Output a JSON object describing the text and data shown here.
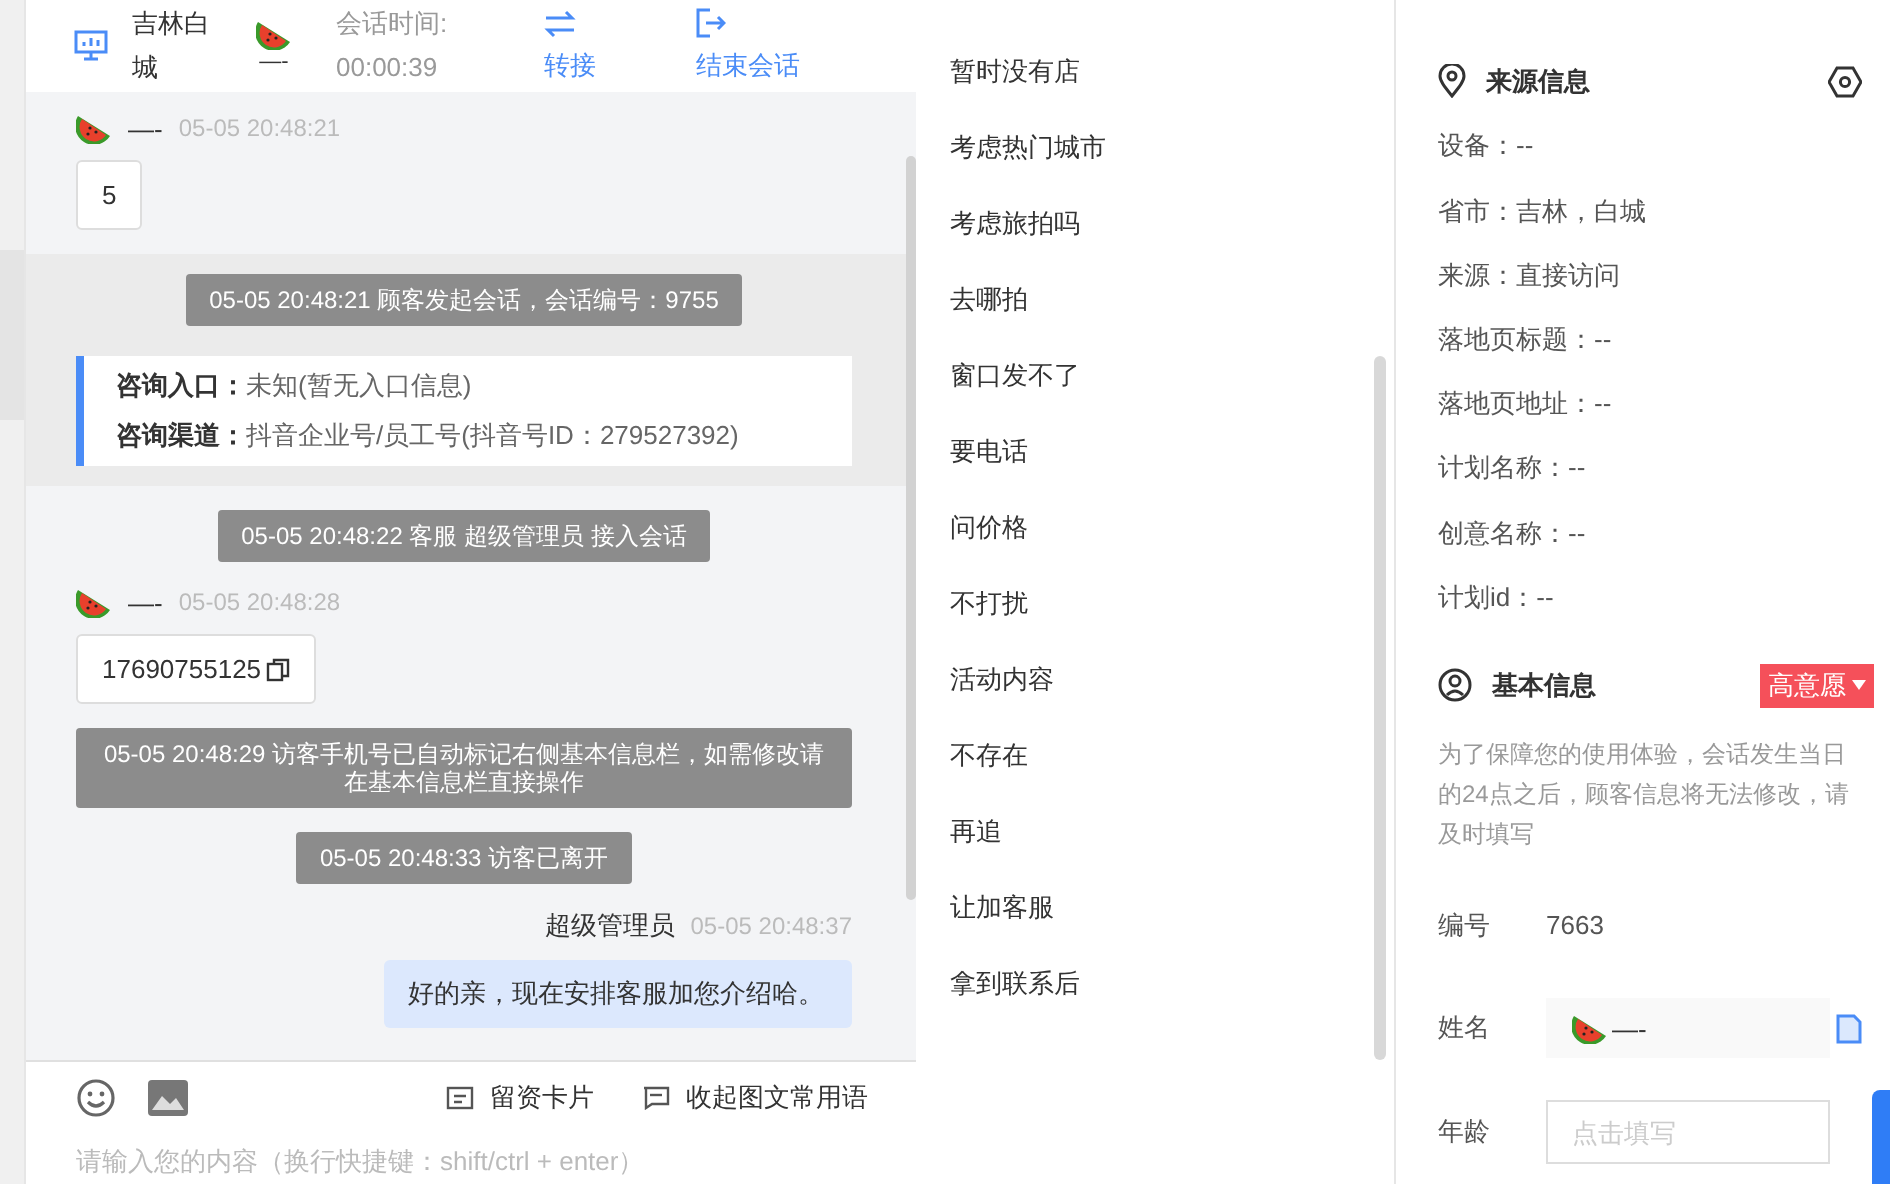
{
  "header": {
    "location": "吉林白城",
    "visitor_name": "—-",
    "timer_label": "会话时间:",
    "timer": "00:00:39",
    "actions": [
      {
        "kind": "transfer",
        "label": "转接"
      },
      {
        "kind": "end",
        "label": "结束会话"
      }
    ]
  },
  "messages": [
    {
      "kind": "visitor",
      "name": "—-",
      "time": "05-05 20:48:21",
      "text": "5",
      "copyable": false
    },
    {
      "kind": "session",
      "text": "05-05 20:48:21 顾客发起会话，会话编号：9755",
      "rows": [
        {
          "label": "咨询入口：",
          "value": "未知(暂无入口信息)"
        },
        {
          "label": "咨询渠道：",
          "value": "抖音企业号/员工号(抖音号ID：279527392)"
        }
      ]
    },
    {
      "kind": "system",
      "text": "05-05 20:48:22 客服 超级管理员 接入会话"
    },
    {
      "kind": "visitor",
      "name": "—-",
      "time": "05-05 20:48:28",
      "text": "17690755125",
      "copyable": true
    },
    {
      "kind": "system",
      "text": "05-05 20:48:29 访客手机号已自动标记右侧基本信息栏，如需修改请在基本信息栏直接操作"
    },
    {
      "kind": "system",
      "text": "05-05 20:48:33 访客已离开"
    },
    {
      "kind": "agent",
      "name": "超级管理员",
      "time": "05-05 20:48:37",
      "text": "好的亲，现在安排客服加您介绍哈。"
    }
  ],
  "composer": {
    "buttons": [
      {
        "kind": "card",
        "label": "留资卡片"
      },
      {
        "kind": "collapse",
        "label": "收起图文常用语"
      }
    ],
    "placeholder": "请输入您的内容（换行快捷键：shift/ctrl + enter）"
  },
  "quick_replies": [
    "暂时没有店",
    "考虑热门城市",
    "考虑旅拍吗",
    "去哪拍",
    "窗口发不了",
    "要电话",
    "问价格",
    "不打扰",
    "活动内容",
    "不存在",
    "再追",
    "让加客服",
    "拿到联系后"
  ],
  "source_info": {
    "title": "来源信息",
    "rows": [
      "设备：--",
      "省市：吉林，白城",
      "来源：直接访问",
      "落地页标题：--",
      "落地页地址：--",
      "计划名称：--",
      "创意名称：--",
      "计划id：--"
    ]
  },
  "basic_info": {
    "title": "基本信息",
    "intent": "高意愿",
    "notice": "为了保障您的使用体验，会话发生当日的24点之后，顾客信息将无法修改，请及时填写",
    "fields": [
      {
        "kind": "text",
        "label": "编号",
        "value": "7663"
      },
      {
        "kind": "name",
        "label": "姓名",
        "value": "—-"
      },
      {
        "kind": "input",
        "label": "年龄",
        "placeholder": "点击填写"
      }
    ]
  }
}
